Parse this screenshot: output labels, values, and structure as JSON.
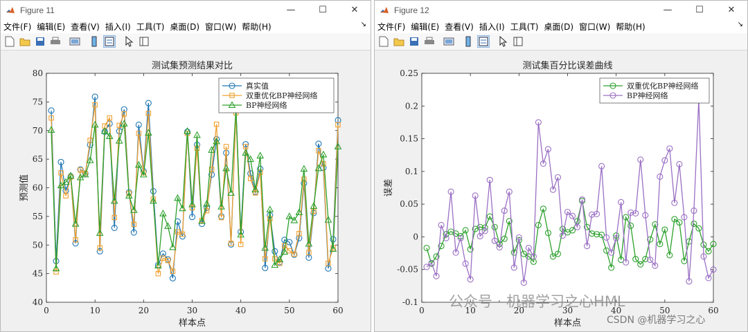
{
  "windows": [
    {
      "title": "Figure 11",
      "menus": [
        "文件(F)",
        "编辑(E)",
        "查看(V)",
        "插入(I)",
        "工具(T)",
        "桌面(D)",
        "窗口(W)",
        "帮助(H)"
      ]
    },
    {
      "title": "Figure 12",
      "menus": [
        "文件(F)",
        "编辑(E)",
        "查看(V)",
        "插入(I)",
        "工具(T)",
        "桌面(D)",
        "窗口(W)",
        "帮助(H)"
      ]
    }
  ],
  "toolbar_icons": [
    "new-figure-icon",
    "open-file-icon",
    "save-icon",
    "print-icon",
    "link-plot-icon",
    "insert-colorbar-icon",
    "insert-legend-icon",
    "edit-plot-icon",
    "property-inspector-icon"
  ],
  "window_controls": [
    "minimize-icon",
    "maximize-icon",
    "close-icon"
  ],
  "watermark": {
    "main": "公众号 · 机器学习之心HML",
    "csdn": "CSDN @机器学习之心"
  },
  "colors": {
    "series_blue": "#1f77b4",
    "series_orange": "#f0a030",
    "series_green": "#2ca02c",
    "series_purple": "#9a6fc4",
    "figure_bg": "#f0f0f0",
    "axes_bg": "#ffffff"
  },
  "chart_data": [
    {
      "type": "line",
      "title": "测试集预测结果对比",
      "xlabel": "样本点",
      "ylabel": "预测值",
      "xlim": [
        0,
        60
      ],
      "ylim": [
        40,
        80
      ],
      "xticks": [
        0,
        10,
        20,
        30,
        40,
        50,
        60
      ],
      "yticks": [
        40,
        45,
        50,
        55,
        60,
        65,
        70,
        75,
        80
      ],
      "grid": false,
      "legend_position": "top-right",
      "x": [
        1,
        2,
        3,
        4,
        5,
        6,
        7,
        8,
        9,
        10,
        11,
        12,
        13,
        14,
        15,
        16,
        17,
        18,
        19,
        20,
        21,
        22,
        23,
        24,
        25,
        26,
        27,
        28,
        29,
        30,
        31,
        32,
        33,
        34,
        35,
        36,
        37,
        38,
        39,
        40,
        41,
        42,
        43,
        44,
        45,
        46,
        47,
        48,
        49,
        50,
        51,
        52,
        53,
        54,
        55,
        56,
        57,
        58,
        59,
        60
      ],
      "series": [
        {
          "name": "真实值",
          "marker": "circle",
          "color": "#1f77b4",
          "values": [
            73.5,
            47.2,
            64.5,
            59.5,
            62.0,
            50.3,
            63.2,
            62.5,
            67.5,
            75.9,
            48.9,
            69.8,
            71.2,
            53.0,
            69.9,
            73.7,
            59.2,
            52.2,
            71.0,
            62.9,
            74.8,
            59.4,
            46.5,
            48.5,
            47.5,
            44.2,
            54.1,
            51.5,
            69.8,
            54.9,
            67.5,
            53.7,
            56.5,
            62.3,
            68.5,
            55.0,
            66.1,
            50.1,
            73.8,
            52.3,
            67.6,
            62.5,
            59.3,
            63.3,
            46.0,
            55.2,
            48.9,
            47.0,
            50.9,
            50.5,
            48.3,
            51.2,
            60.8,
            47.8,
            55.6,
            67.7,
            63.5,
            45.9,
            51.0,
            71.8
          ]
        },
        {
          "name": "双重优化BP神经网络",
          "marker": "square",
          "color": "#f0a030",
          "values": [
            72.2,
            45.3,
            62.6,
            58.6,
            61.9,
            50.9,
            63.1,
            62.5,
            68.3,
            74.5,
            49.5,
            70.8,
            72.2,
            54.8,
            70.9,
            72.9,
            59.0,
            53.6,
            69.5,
            62.6,
            73.0,
            58.0,
            45.0,
            47.7,
            47.3,
            45.4,
            52.3,
            51.9,
            69.5,
            56.5,
            66.9,
            54.3,
            56.0,
            63.2,
            71.1,
            54.8,
            67.2,
            50.3,
            73.1,
            50.1,
            67.2,
            61.6,
            59.1,
            62.7,
            47.6,
            54.6,
            47.6,
            46.8,
            49.9,
            49.0,
            48.4,
            52.0,
            61.5,
            48.7,
            55.9,
            66.5,
            64.2,
            46.8,
            49.5,
            71.0
          ]
        },
        {
          "name": "BP神经网络",
          "marker": "triangle",
          "color": "#2ca02c",
          "values": [
            70.1,
            45.9,
            60.4,
            61.0,
            62.1,
            53.7,
            61.8,
            62.3,
            64.8,
            71.0,
            52.1,
            69.9,
            69.0,
            57.7,
            68.2,
            71.2,
            58.6,
            56.1,
            64.0,
            62.3,
            69.6,
            57.7,
            46.4,
            55.5,
            53.3,
            49.6,
            58.2,
            56.4,
            69.9,
            57.1,
            69.2,
            54.2,
            57.2,
            66.6,
            68.1,
            56.7,
            63.4,
            59.1,
            73.9,
            51.8,
            66.1,
            65.0,
            59.7,
            65.6,
            49.5,
            56.2,
            46.5,
            47.5,
            48.8,
            55.0,
            54.3,
            55.7,
            63.3,
            50.2,
            56.8,
            63.4,
            65.8,
            54.4,
            49.3,
            67.2
          ]
        }
      ]
    },
    {
      "type": "line",
      "title": "测试集百分比误差曲线",
      "xlabel": "样本点",
      "ylabel": "误差",
      "xlim": [
        0,
        60
      ],
      "ylim": [
        -0.1,
        0.25
      ],
      "xticks": [
        0,
        10,
        20,
        30,
        40,
        50,
        60
      ],
      "yticks": [
        -0.1,
        -0.05,
        0,
        0.05,
        0.1,
        0.15,
        0.2,
        0.25
      ],
      "ytick_labels": [
        "-0.1",
        "-0.05",
        "0",
        "0.05",
        "0.1",
        "0.15",
        "0.2",
        "0.25"
      ],
      "grid": false,
      "legend_position": "top-right",
      "x": [
        1,
        2,
        3,
        4,
        5,
        6,
        7,
        8,
        9,
        10,
        11,
        12,
        13,
        14,
        15,
        16,
        17,
        18,
        19,
        20,
        21,
        22,
        23,
        24,
        25,
        26,
        27,
        28,
        29,
        30,
        31,
        32,
        33,
        34,
        35,
        36,
        37,
        38,
        39,
        40,
        41,
        42,
        43,
        44,
        45,
        46,
        47,
        48,
        49,
        50,
        51,
        52,
        53,
        54,
        55,
        56,
        57,
        58,
        59,
        60
      ],
      "series": [
        {
          "name": "双重优化BP神经网络",
          "marker": "circle",
          "color": "#2ca02c",
          "values": [
            -0.017,
            -0.041,
            -0.03,
            -0.014,
            0.004,
            0.008,
            0.005,
            0.001,
            0.01,
            -0.019,
            0.012,
            0.015,
            0.014,
            0.031,
            0.015,
            -0.011,
            -0.003,
            0.024,
            -0.024,
            -0.005,
            -0.026,
            -0.03,
            -0.038,
            0.018,
            0.043,
            0.006,
            -0.03,
            -0.026,
            0.012,
            0.007,
            0.01,
            0.024,
            0.055,
            0.015,
            0.005,
            0.004,
            0.003,
            -0.021,
            -0.047,
            0.002,
            -0.035,
            0.03,
            0.017,
            -0.034,
            -0.042,
            -0.034,
            -0.004,
            0.019,
            -0.011,
            0.011,
            -0.028,
            0.027,
            0.022,
            -0.037,
            -0.007,
            0.02,
            0.013,
            -0.012,
            -0.022,
            -0.011
          ]
        },
        {
          "name": "BP神经网络",
          "marker": "circle",
          "color": "#9a6fc4",
          "values": [
            -0.046,
            -0.04,
            -0.06,
            0.018,
            -0.002,
            0.069,
            -0.024,
            -0.002,
            -0.041,
            -0.065,
            0.063,
            0.001,
            0.009,
            0.087,
            -0.006,
            -0.016,
            0.04,
            0.069,
            -0.047,
            -0.001,
            -0.07,
            -0.017,
            -0.03,
            0.175,
            0.112,
            0.134,
            0.072,
            0.091,
            0.002,
            0.038,
            0.032,
            0.015,
            0.057,
            -0.014,
            0.034,
            0.035,
            0.108,
            -0.001,
            -0.024,
            -0.002,
            0.053,
            -0.039,
            0.037,
            0.036,
            0.118,
            0.033,
            -0.035,
            -0.044,
            0.092,
            0.117,
            0.135,
            0.052,
            0.111,
            0.03,
            -0.068,
            0.04,
            0.21,
            -0.03,
            -0.063,
            -0.05
          ]
        }
      ]
    }
  ]
}
